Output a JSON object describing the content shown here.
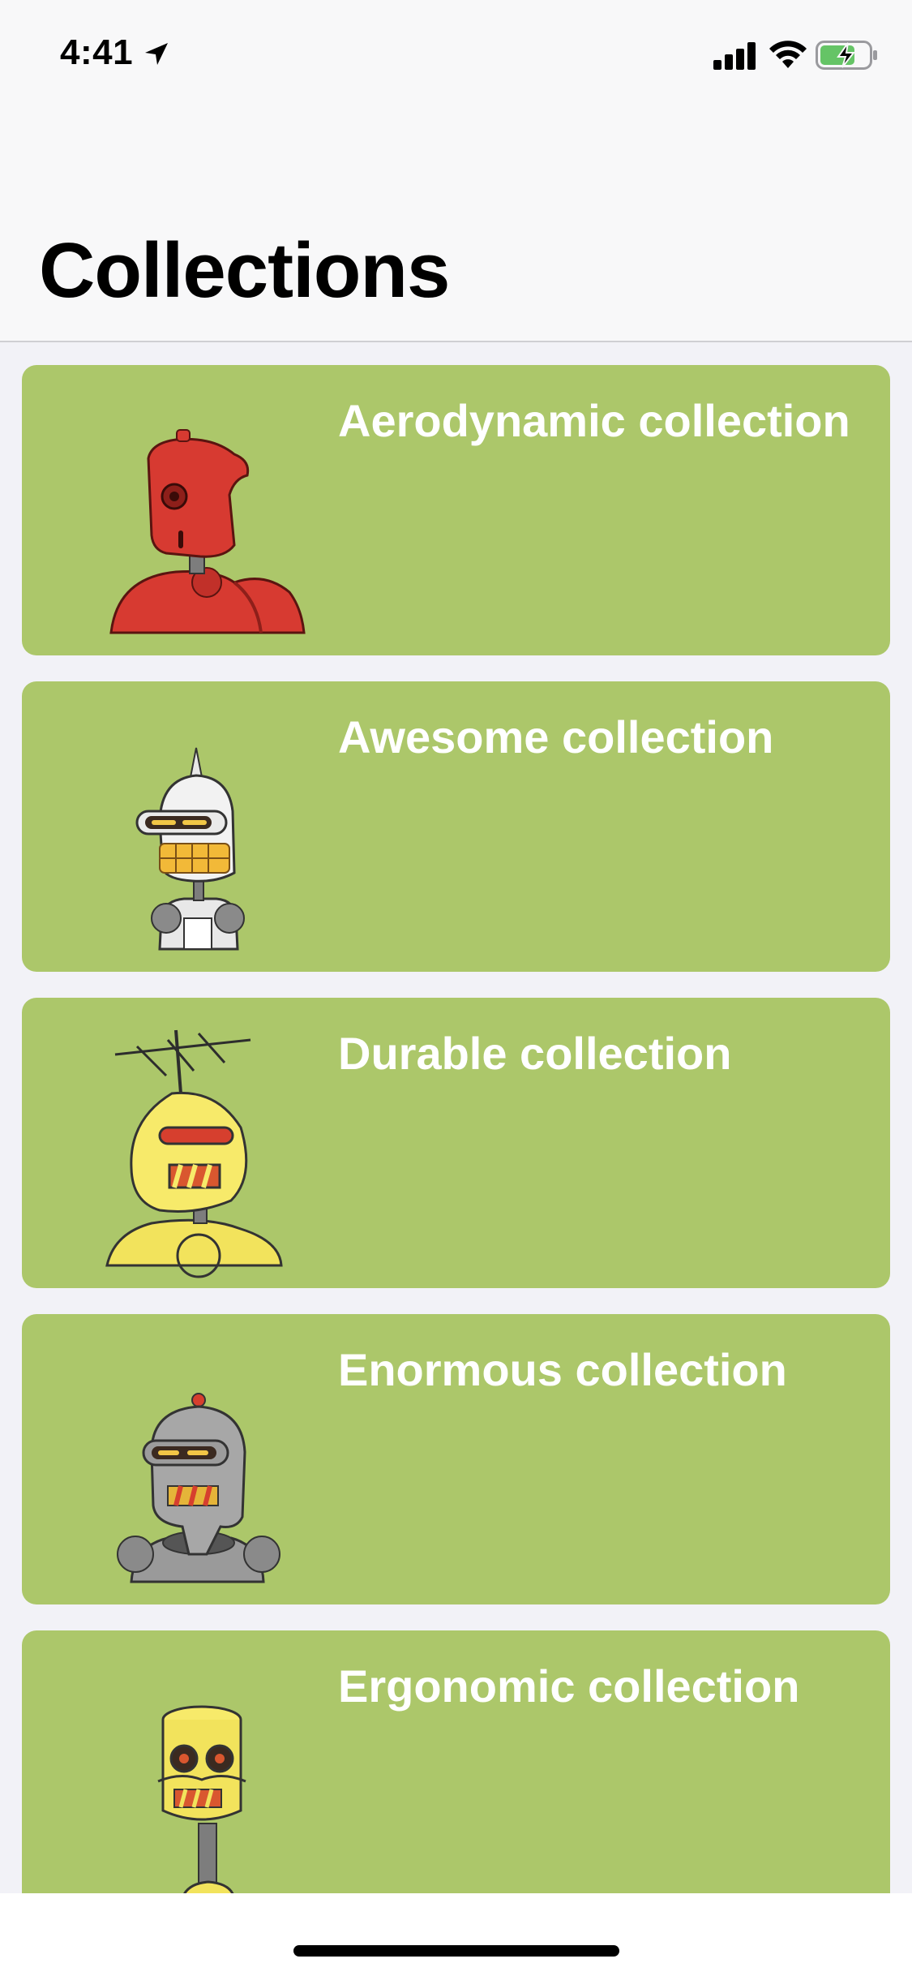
{
  "status_bar": {
    "time": "4:41",
    "location_icon": "location-arrow-icon",
    "signal_icon": "cellular-signal-icon",
    "wifi_icon": "wifi-icon",
    "battery_icon": "battery-charging-icon",
    "battery_color": "#65c466"
  },
  "nav": {
    "title": "Collections"
  },
  "collections": [
    {
      "title": "Aerodynamic collection",
      "robot": "red-robot",
      "color": "#acc76a"
    },
    {
      "title": "Awesome collection",
      "robot": "white-robot",
      "color": "#acc76a"
    },
    {
      "title": "Durable collection",
      "robot": "yellow-antenna-robot",
      "color": "#acc76a"
    },
    {
      "title": "Enormous collection",
      "robot": "gray-robot",
      "color": "#acc76a"
    },
    {
      "title": "Ergonomic collection",
      "robot": "yellow-cylinder-robot",
      "color": "#acc76a"
    }
  ]
}
